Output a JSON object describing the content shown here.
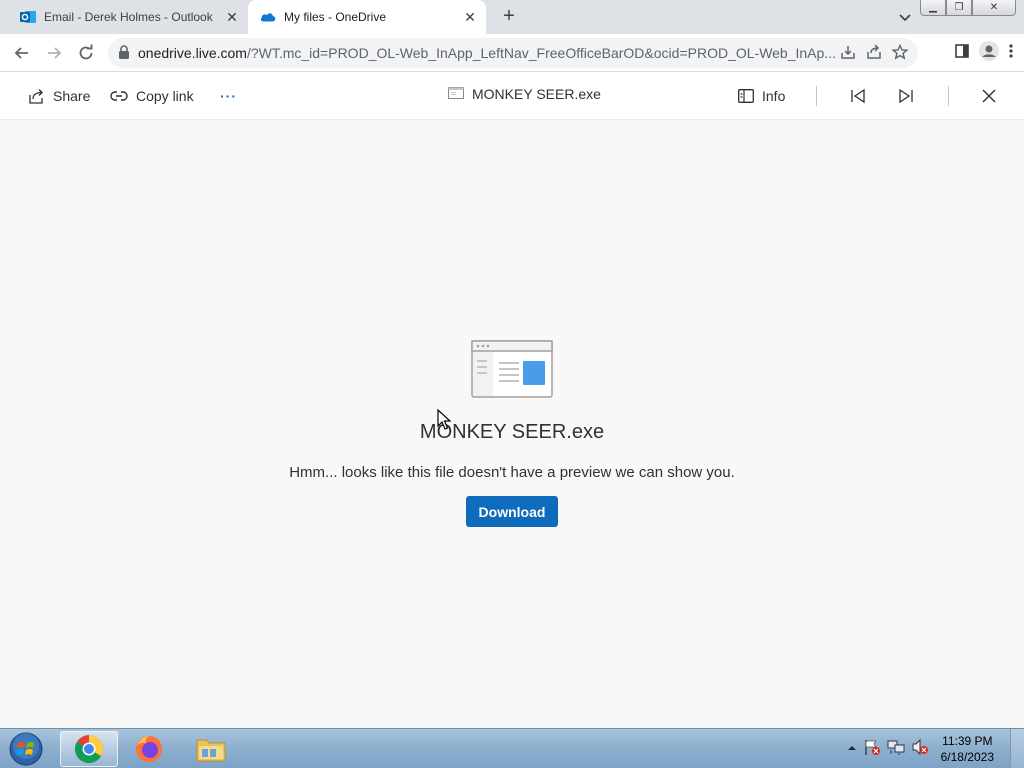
{
  "browser": {
    "tabs": [
      {
        "title": "Email - Derek Holmes - Outlook",
        "icon": "outlook-icon",
        "active": false
      },
      {
        "title": "My files - OneDrive",
        "icon": "onedrive-icon",
        "active": true
      }
    ],
    "new_tab_label": "+",
    "address": {
      "host": "onedrive.live.com",
      "path": "/?WT.mc_id=PROD_OL-Web_InApp_LeftNav_FreeOfficeBarOD&ocid=PROD_OL-Web_InAp..."
    }
  },
  "commandbar": {
    "share_label": "Share",
    "copy_link_label": "Copy link",
    "more_label": "···",
    "file_title": "MONKEY SEER.exe",
    "info_label": "Info"
  },
  "preview": {
    "filename": "MONKEY SEER.exe",
    "message": "Hmm... looks like this file doesn't have a preview we can show you.",
    "download_label": "Download"
  },
  "taskbar": {
    "apps": [
      "chrome",
      "firefox",
      "file-explorer"
    ],
    "time": "11:39 PM",
    "date": "6/18/2023"
  },
  "colors": {
    "accent": "#0f6cbd",
    "tabstrip": "#dee1e6",
    "background": "#f8f8f8"
  }
}
